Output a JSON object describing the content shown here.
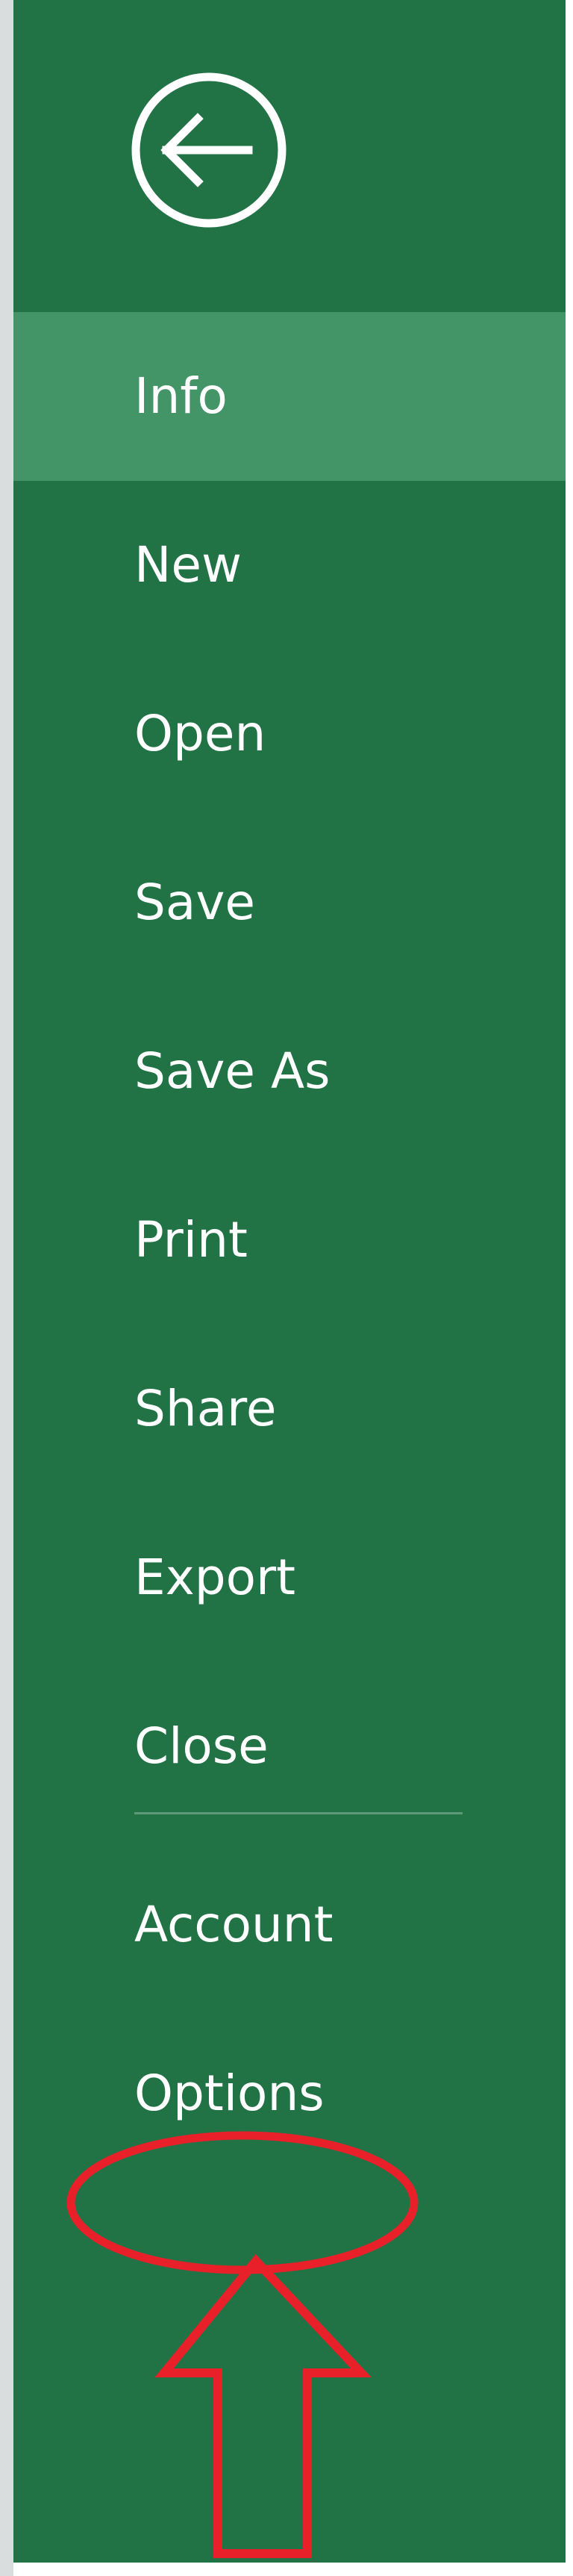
{
  "backstage": {
    "back_button": {
      "icon": "back-arrow-icon"
    },
    "colors": {
      "background": "#217346",
      "selected": "#439467",
      "text": "#ffffff",
      "annotation": "#e8202a"
    },
    "menu": {
      "info": "Info",
      "new": "New",
      "open": "Open",
      "save": "Save",
      "save_as": "Save As",
      "print": "Print",
      "share": "Share",
      "export": "Export",
      "close": "Close",
      "account": "Account",
      "options": "Options"
    },
    "selected_item": "Info"
  }
}
